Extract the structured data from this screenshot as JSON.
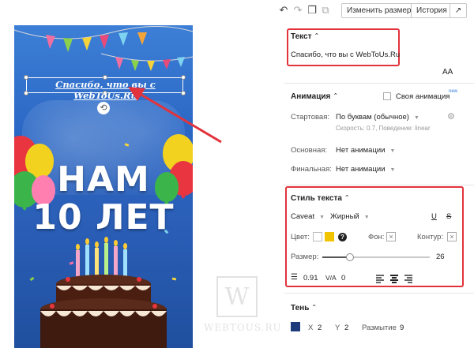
{
  "toolbar": {
    "undo_icon": "undo-icon",
    "redo_icon": "redo-icon",
    "copy_icon": "copy-icon",
    "duplicate_icon": "duplicate-icon",
    "resize_label": "Изменить размер",
    "history_label": "История",
    "external_icon": "external-link-icon"
  },
  "story": {
    "caption": "Спасибо, что вы с WebToUs.Ru",
    "headline_line1": "НАМ",
    "headline_line2": "10 ЛЕТ",
    "background_color": "#2a66c4"
  },
  "watermark": {
    "letter": "W",
    "text": "WEBTOUS.RU"
  },
  "text_section": {
    "title": "Текст",
    "content": "Спасибо, что вы с WebToUs.Ru",
    "font_size_icon_label": "AA"
  },
  "animation_section": {
    "title": "Анимация",
    "custom_label": "Своя анимация",
    "custom_badge": "new",
    "start_label": "Стартовая:",
    "start_value": "По буквам (обычное)",
    "start_hint": "Скорость: 0.7, Поведение: linear",
    "main_label": "Основная:",
    "main_value": "Нет анимации",
    "final_label": "Финальная:",
    "final_value": "Нет анимации"
  },
  "text_style_section": {
    "title": "Стиль текста",
    "font_family": "Caveat",
    "font_weight": "Жирный",
    "underline_symbol": "U",
    "strike_symbol": "S",
    "color_label": "Цвет:",
    "color_white": "#ffffff",
    "color_yellow": "#f2c400",
    "help_symbol": "?",
    "bg_label": "Фон:",
    "outline_label": "Контур:",
    "size_label": "Размер:",
    "size_value": "26",
    "size_fraction": 0.25,
    "line_height_value": "0.91",
    "letter_spacing_symbol": "V/A",
    "letter_spacing_value": "0"
  },
  "shadow_section": {
    "title": "Тень",
    "color": "#1d3a7a",
    "x_label": "X",
    "x_value": "2",
    "y_label": "Y",
    "y_value": "2",
    "blur_label": "Размытие",
    "blur_value": "9"
  },
  "accent": {
    "red_highlight": "#e2333c",
    "arrow": "#e2333c"
  }
}
